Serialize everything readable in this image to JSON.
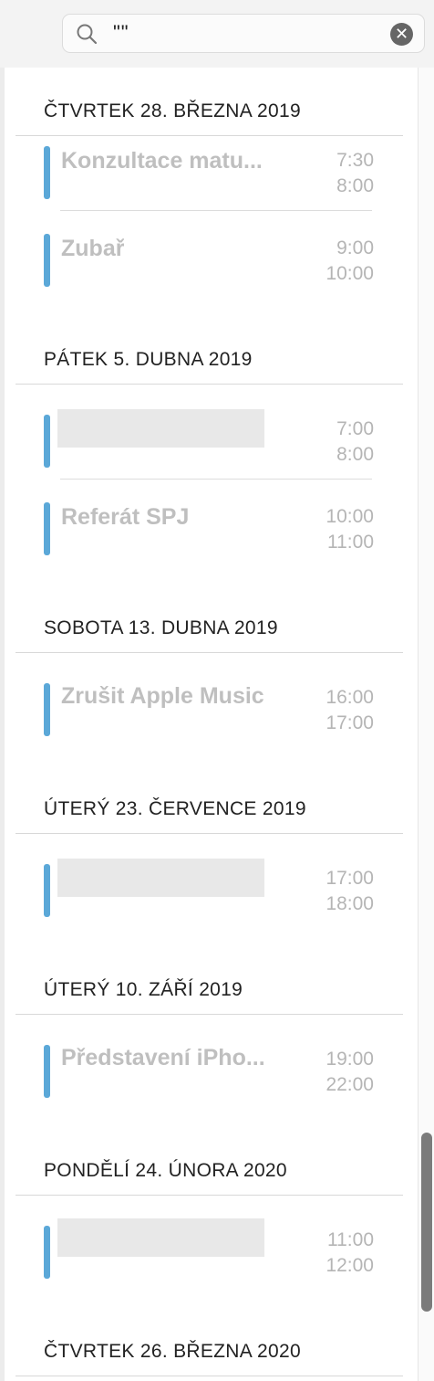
{
  "search": {
    "query": "\"\""
  },
  "icons": {
    "search": "search-icon",
    "clear": "clear-icon",
    "clear_glyph": "✕"
  },
  "colors": {
    "event_accent": "#5ba8d8",
    "muted_text": "#bfbfbf"
  },
  "days": [
    {
      "header": "ČTVRTEK 28. BŘEZNA 2019",
      "events": [
        {
          "title": "Konzultace matu...",
          "start": "7:30",
          "end": "8:00"
        },
        {
          "title": "Zubař",
          "start": "9:00",
          "end": "10:00"
        }
      ]
    },
    {
      "header": "PÁTEK 5. DUBNA 2019",
      "events": [
        {
          "title": "",
          "start": "7:00",
          "end": "8:00"
        },
        {
          "title": "Referát SPJ",
          "start": "10:00",
          "end": "11:00"
        }
      ]
    },
    {
      "header": "SOBOTA 13. DUBNA 2019",
      "events": [
        {
          "title": "Zrušit Apple Music",
          "start": "16:00",
          "end": "17:00"
        }
      ]
    },
    {
      "header": "ÚTERÝ 23. ČERVENCE 2019",
      "events": [
        {
          "title": "",
          "start": "17:00",
          "end": "18:00"
        }
      ]
    },
    {
      "header": "ÚTERÝ 10. ZÁŘÍ 2019",
      "events": [
        {
          "title": "Představení iPho...",
          "start": "19:00",
          "end": "22:00"
        }
      ]
    },
    {
      "header": "PONDĚLÍ 24. ÚNORA 2020",
      "events": [
        {
          "title": "",
          "start": "11:00",
          "end": "12:00"
        }
      ]
    },
    {
      "header": "ČTVRTEK 26. BŘEZNA 2020",
      "events": []
    }
  ]
}
